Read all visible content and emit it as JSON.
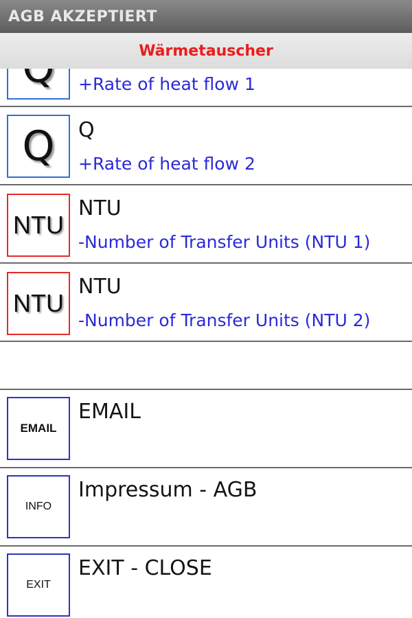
{
  "app": {
    "title": "AGB AKZEPTIERT"
  },
  "header": {
    "title": "Wärmetauscher"
  },
  "list": {
    "items": [
      {
        "icon": "Q",
        "title": "",
        "subtitle": "+Rate of heat flow 1"
      },
      {
        "icon": "Q",
        "title": "Q",
        "subtitle": "+Rate of heat flow 2"
      },
      {
        "icon": "NTU",
        "title": "NTU",
        "subtitle": "-Number of Transfer Units (NTU 1)"
      },
      {
        "icon": "NTU",
        "title": "NTU",
        "subtitle": "-Number of Transfer Units (NTU 2)"
      },
      {
        "icon": "EMAIL",
        "title": "EMAIL"
      },
      {
        "icon": "INFO",
        "title": "Impressum - AGB"
      },
      {
        "icon": "EXIT",
        "title": "EXIT - CLOSE"
      }
    ]
  },
  "colors": {
    "title_bar": "#6e6e6e",
    "header_text": "#ea1d1d",
    "subtitle_text": "#2a2ad8",
    "icon_border_blue": "#2f6fd6",
    "icon_border_red": "#e42a2a",
    "icon_border_navy": "#2b34b8"
  }
}
